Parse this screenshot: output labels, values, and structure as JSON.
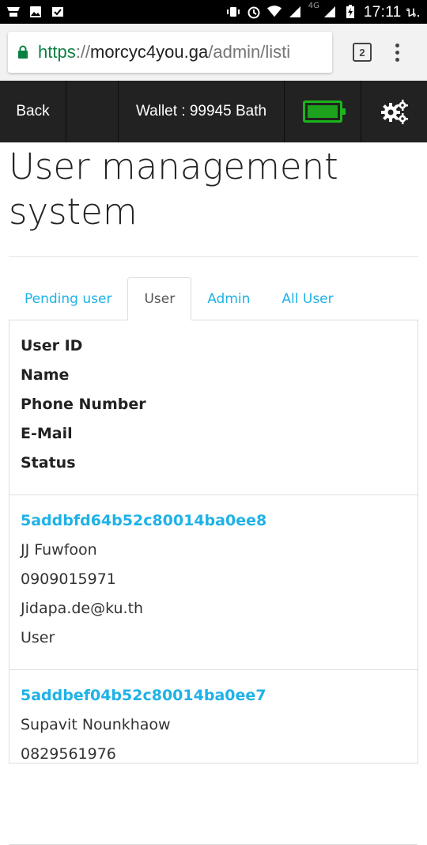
{
  "status_bar": {
    "time": "17:11 น.",
    "network": "4G"
  },
  "browser": {
    "url_scheme": "https",
    "url_separator": "://",
    "url_host": "morcyc4you.ga",
    "url_path": "/admin/listi",
    "tab_count": "2",
    "secure_color": "#0b8043"
  },
  "navbar": {
    "back_label": "Back",
    "wallet_label": "Wallet : 99945 Bath",
    "battery_color": "#1bb51b"
  },
  "page": {
    "title": "User management system"
  },
  "tabs": [
    {
      "label": "Pending user",
      "active": false
    },
    {
      "label": "User",
      "active": true
    },
    {
      "label": "Admin",
      "active": false
    },
    {
      "label": "All User",
      "active": false
    }
  ],
  "table": {
    "headers": [
      "User ID",
      "Name",
      "Phone Number",
      "E-Mail",
      "Status"
    ],
    "rows": [
      {
        "user_id": "5addbfd64b52c80014ba0ee8",
        "name": "JJ Fuwfoon",
        "phone": "0909015971",
        "email": "Jidapa.de@ku.th",
        "status": "User"
      },
      {
        "user_id": "5addbef04b52c80014ba0ee7",
        "name": "Supavit Nounkhaow",
        "phone": "0829561976",
        "email": "",
        "status": ""
      }
    ]
  },
  "colors": {
    "accent": "#1fb2e6",
    "navbar_bg": "#222222"
  }
}
